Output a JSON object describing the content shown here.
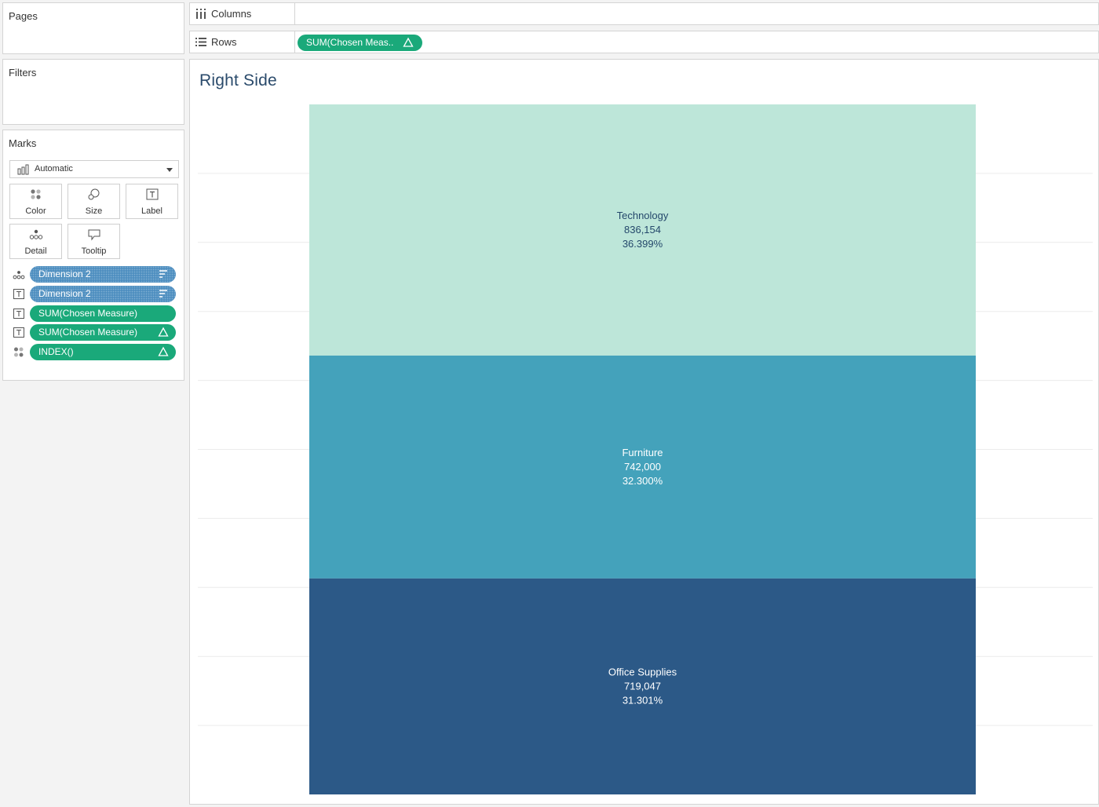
{
  "cards": {
    "pages": {
      "title": "Pages"
    },
    "filters": {
      "title": "Filters"
    },
    "marks": {
      "title": "Marks",
      "mark_type": "Automatic",
      "buttons": {
        "color": "Color",
        "size": "Size",
        "label": "Label",
        "detail": "Detail",
        "tooltip": "Tooltip"
      },
      "fields": [
        {
          "label": "Dimension 2",
          "role": "detail-icon",
          "pill": "blue",
          "tail": "sort-icon"
        },
        {
          "label": "Dimension 2",
          "role": "label-icon",
          "pill": "blue",
          "tail": "sort-icon"
        },
        {
          "label": "SUM(Chosen Measure)",
          "role": "label-icon",
          "pill": "green",
          "tail": ""
        },
        {
          "label": "SUM(Chosen Measure)",
          "role": "label-icon",
          "pill": "green",
          "tail": "delta-icon"
        },
        {
          "label": "INDEX()",
          "role": "color-icon",
          "pill": "green",
          "tail": "delta-icon"
        }
      ]
    }
  },
  "shelves": {
    "columns": {
      "label": "Columns",
      "pills": []
    },
    "rows": {
      "label": "Rows",
      "pill": "SUM(Chosen Meas..",
      "tail": "delta-icon"
    }
  },
  "view": {
    "title": "Right Side"
  },
  "colors": {
    "pill_blue": "#4f8fc0",
    "pill_green": "#1aa97a",
    "title": "#2a4a6b"
  },
  "chart_data": {
    "type": "bar",
    "stacked": true,
    "categories": [
      "Technology",
      "Furniture",
      "Office Supplies"
    ],
    "values": [
      836154,
      742000,
      719047
    ],
    "value_labels": [
      "836,154",
      "742,000",
      "719,047"
    ],
    "percent_labels": [
      "36.399%",
      "32.300%",
      "31.301%"
    ],
    "colors": [
      "#bde6d9",
      "#44a2bb",
      "#2c5987"
    ],
    "label_colors": [
      "#24486b",
      "#ffffff",
      "#ffffff"
    ],
    "title": "Right Side",
    "xlabel": "",
    "ylabel": "",
    "grid": true
  }
}
